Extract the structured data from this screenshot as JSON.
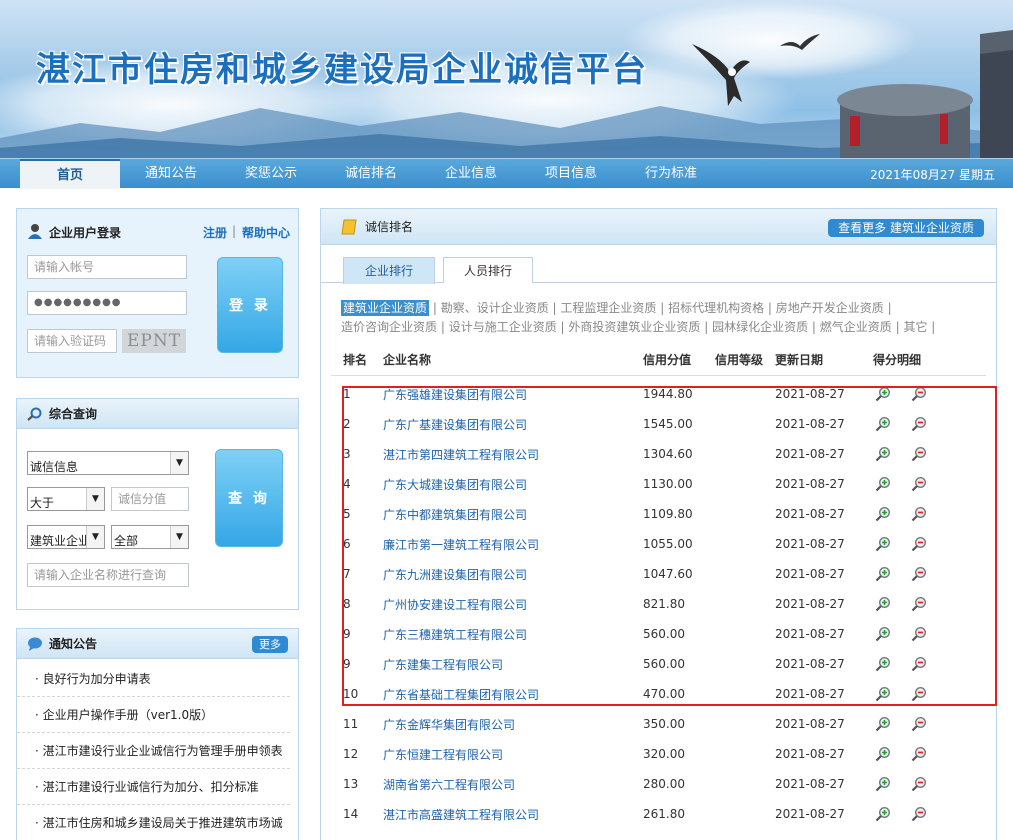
{
  "banner": {
    "title": "湛江市住房和城乡建设局企业诚信平台"
  },
  "nav": {
    "items": [
      "首页",
      "通知公告",
      "奖惩公示",
      "诚信排名",
      "企业信息",
      "项目信息",
      "行为标准"
    ],
    "date": "2021年08月27 星期五"
  },
  "login": {
    "title": "企业用户登录",
    "register": "注册",
    "separator": "|",
    "help": "帮助中心",
    "account_placeholder": "请输入帐号",
    "password_value": "●●●●●●●●●",
    "captcha_placeholder": "请输入验证码",
    "captcha_code": "EPNT",
    "login_button": "登 录"
  },
  "search": {
    "title": "综合查询",
    "type_select": "诚信信息",
    "compare_select": "大于",
    "score_placeholder": "诚信分值",
    "category_select": "建筑业企业",
    "range_select": "全部",
    "name_placeholder": "请输入企业名称进行查询",
    "query_button": "查 询"
  },
  "notice": {
    "title": "通知公告",
    "more": "更多",
    "items": [
      "· 良好行为加分申请表",
      "· 企业用户操作手册（ver1.0版）",
      "· 湛江市建设行业企业诚信行为管理手册申领表",
      "· 湛江市建设行业诚信行为加分、扣分标准",
      "· 湛江市住房和城乡建设局关于推进建筑市场诚"
    ]
  },
  "ranking": {
    "title": "诚信排名",
    "more_button": "查看更多 建筑业企业资质",
    "tabs": [
      "企业排行",
      "人员排行"
    ],
    "categories_line1": [
      "建筑业企业资质",
      "勘察、设计企业资质",
      "工程监理企业资质",
      "招标代理机构资格",
      "房地产开发企业资质"
    ],
    "categories_line2": [
      "造价咨询企业资质",
      "设计与施工企业资质",
      "外商投资建筑业企业资质",
      "园林绿化企业资质",
      "燃气企业资质",
      "其它"
    ],
    "columns": [
      "排名",
      "企业名称",
      "信用分值",
      "信用等级",
      "更新日期",
      "得分明细"
    ],
    "rows": [
      {
        "rank": "1",
        "name": "广东强雄建设集团有限公司",
        "score": "1944.80",
        "level": "",
        "date": "2021-08-27"
      },
      {
        "rank": "2",
        "name": "广东广基建设集团有限公司",
        "score": "1545.00",
        "level": "",
        "date": "2021-08-27"
      },
      {
        "rank": "3",
        "name": "湛江市第四建筑工程有限公司",
        "score": "1304.60",
        "level": "",
        "date": "2021-08-27"
      },
      {
        "rank": "4",
        "name": "广东大城建设集团有限公司",
        "score": "1130.00",
        "level": "",
        "date": "2021-08-27"
      },
      {
        "rank": "5",
        "name": "广东中都建筑集团有限公司",
        "score": "1109.80",
        "level": "",
        "date": "2021-08-27"
      },
      {
        "rank": "6",
        "name": "廉江市第一建筑工程有限公司",
        "score": "1055.00",
        "level": "",
        "date": "2021-08-27"
      },
      {
        "rank": "7",
        "name": "广东九洲建设集团有限公司",
        "score": "1047.60",
        "level": "",
        "date": "2021-08-27"
      },
      {
        "rank": "8",
        "name": "广州协安建设工程有限公司",
        "score": "821.80",
        "level": "",
        "date": "2021-08-27"
      },
      {
        "rank": "9",
        "name": "广东三穗建筑工程有限公司",
        "score": "560.00",
        "level": "",
        "date": "2021-08-27"
      },
      {
        "rank": "9",
        "name": "广东建集工程有限公司",
        "score": "560.00",
        "level": "",
        "date": "2021-08-27"
      },
      {
        "rank": "10",
        "name": "广东省基础工程集团有限公司",
        "score": "470.00",
        "level": "",
        "date": "2021-08-27"
      },
      {
        "rank": "11",
        "name": "广东金辉华集团有限公司",
        "score": "350.00",
        "level": "",
        "date": "2021-08-27"
      },
      {
        "rank": "12",
        "name": "广东恒建工程有限公司",
        "score": "320.00",
        "level": "",
        "date": "2021-08-27"
      },
      {
        "rank": "13",
        "name": "湖南省第六工程有限公司",
        "score": "280.00",
        "level": "",
        "date": "2021-08-27"
      },
      {
        "rank": "14",
        "name": "湛江市高盛建筑工程有限公司",
        "score": "261.80",
        "level": "",
        "date": "2021-08-27"
      }
    ]
  },
  "colors": {
    "brand": "#1a6fbf",
    "nav": "#3a8fce",
    "highlight_box": "#e02020",
    "link": "#1f62a8"
  },
  "icons": {
    "detail_add": "magnifier-plus-icon",
    "detail_minus": "magnifier-minus-icon"
  }
}
